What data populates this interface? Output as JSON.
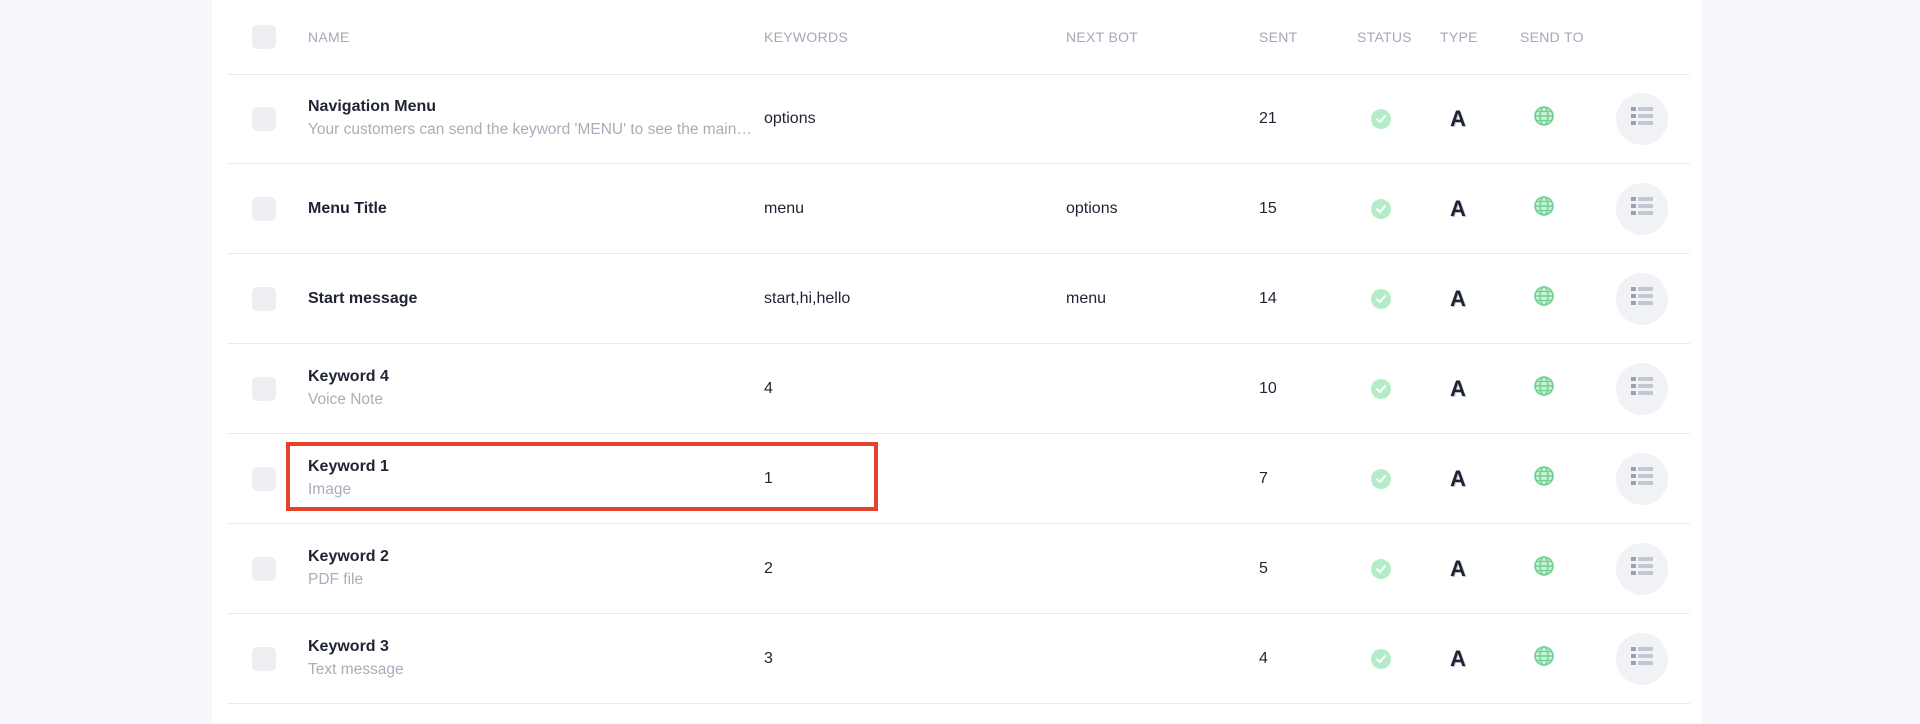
{
  "columns": {
    "name": "NAME",
    "keywords": "KEYWORDS",
    "next_bot": "NEXT BOT",
    "sent": "SENT",
    "status": "STATUS",
    "type": "TYPE",
    "send_to": "SEND TO"
  },
  "rows": [
    {
      "title": "Navigation Menu",
      "subtitle": "Your customers can send the keyword 'MENU' to see the main menu",
      "keywords": "options",
      "next_bot": "",
      "sent": "21",
      "type_glyph": "A"
    },
    {
      "title": "Menu Title",
      "subtitle": "",
      "keywords": "menu",
      "next_bot": "options",
      "sent": "15",
      "type_glyph": "A"
    },
    {
      "title": "Start message",
      "subtitle": "",
      "keywords": "start,hi,hello",
      "next_bot": "menu",
      "sent": "14",
      "type_glyph": "A"
    },
    {
      "title": "Keyword 4",
      "subtitle": "Voice Note",
      "keywords": "4",
      "next_bot": "",
      "sent": "10",
      "type_glyph": "A"
    },
    {
      "title": "Keyword 1",
      "subtitle": "Image",
      "keywords": "1",
      "next_bot": "",
      "sent": "7",
      "type_glyph": "A"
    },
    {
      "title": "Keyword 2",
      "subtitle": "PDF file",
      "keywords": "2",
      "next_bot": "",
      "sent": "5",
      "type_glyph": "A"
    },
    {
      "title": "Keyword 3",
      "subtitle": "Text message",
      "keywords": "3",
      "next_bot": "",
      "sent": "4",
      "type_glyph": "A"
    }
  ],
  "icons": {
    "status": "check-circle-icon",
    "send_to": "globe-icon",
    "action": "list-icon"
  },
  "colors": {
    "status_bg": "#b5ecc8",
    "status_check": "#ffffff",
    "globe": "#6fd08f",
    "highlight": "#e8432a"
  },
  "highlighted_row": 4
}
